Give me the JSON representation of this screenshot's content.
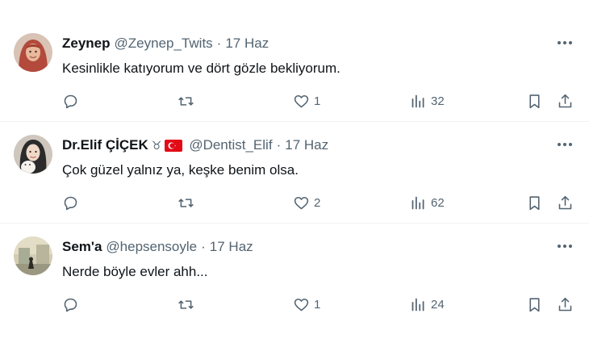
{
  "tweets": [
    {
      "author_name": "Zeynep",
      "handle": "@Zeynep_Twits",
      "separator": "·",
      "date": "17 Haz",
      "text": "Kesinlikle katıyorum ve dört gözle bekliyorum.",
      "replies": "",
      "retweets": "",
      "likes": "1",
      "views": "32",
      "avatar_colors": [
        "#c98a6a",
        "#e8b7a0",
        "#b0453a"
      ]
    },
    {
      "author_name": "Dr.Elif ÇİÇEK",
      "name_suffix": "♉",
      "handle": "@Dentist_Elif",
      "separator": "·",
      "date": "17 Haz",
      "text": "Çok güzel yalnız ya, keşke benim olsa.",
      "replies": "",
      "retweets": "",
      "likes": "2",
      "views": "62",
      "avatar_colors": [
        "#3a3a3a",
        "#f1e6dc",
        "#d9c8b8"
      ]
    },
    {
      "author_name": "Sem'a",
      "handle": "@hepsensoyle",
      "separator": "·",
      "date": "17 Haz",
      "text": "Nerde böyle evler ahh...",
      "replies": "",
      "retweets": "",
      "likes": "1",
      "views": "24",
      "avatar_colors": [
        "#c9c2a8",
        "#8f9a87",
        "#3d3a34"
      ]
    }
  ],
  "colors": {
    "text_primary": "#0f1419",
    "text_secondary": "#536471",
    "divider": "#eff3f4",
    "flag_red": "#e30a17"
  },
  "icons": [
    "reply-icon",
    "retweet-icon",
    "like-icon",
    "views-icon",
    "bookmark-icon",
    "share-icon",
    "more-icon",
    "turkey-flag-icon"
  ]
}
